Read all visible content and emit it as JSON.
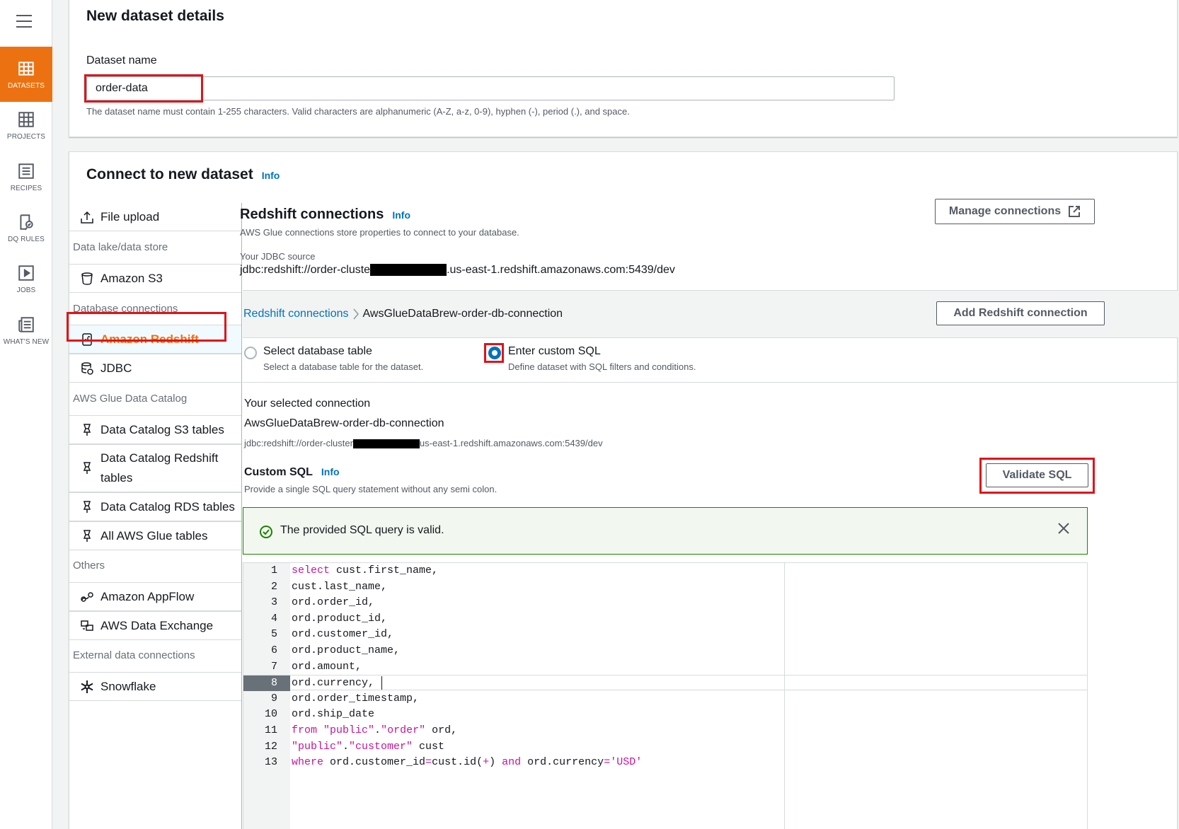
{
  "rail": {
    "items": [
      {
        "label": "DATASETS",
        "icon": "table-icon"
      },
      {
        "label": "PROJECTS",
        "icon": "grid-icon"
      },
      {
        "label": "RECIPES",
        "icon": "list-icon"
      },
      {
        "label": "DQ RULES",
        "icon": "rules-icon"
      },
      {
        "label": "JOBS",
        "icon": "play-icon"
      },
      {
        "label": "WHAT'S NEW",
        "icon": "news-icon"
      }
    ]
  },
  "details": {
    "title": "New dataset details",
    "name_label": "Dataset name",
    "name_value": "order-data",
    "name_hint": "The dataset name must contain 1-255 characters. Valid characters are alphanumeric (A-Z, a-z, 0-9), hyphen (-), period (.), and space."
  },
  "connect": {
    "title": "Connect to new dataset",
    "info": "Info"
  },
  "sources": {
    "file_upload": "File upload",
    "group_lake": "Data lake/data store",
    "s3": "Amazon S3",
    "group_db": "Database connections",
    "redshift": "Amazon Redshift",
    "jdbc": "JDBC",
    "group_catalog": "AWS Glue Data Catalog",
    "catalog_s3": "Data Catalog S3 tables",
    "catalog_redshift_1": "Data Catalog Redshift",
    "catalog_redshift_2": "tables",
    "catalog_rds": "Data Catalog RDS tables",
    "all_glue": "All AWS Glue tables",
    "group_others": "Others",
    "appflow": "Amazon AppFlow",
    "data_exchange": "AWS Data Exchange",
    "group_external": "External data connections",
    "snowflake": "Snowflake"
  },
  "redshift": {
    "title": "Redshift connections",
    "info": "Info",
    "subtitle": "AWS Glue connections store properties to connect to your database.",
    "manage_btn": "Manage connections",
    "jdbc_label": "Your JDBC source",
    "jdbc_prefix": "jdbc:redshift://order-cluste",
    "jdbc_suffix": ".us-east-1.redshift.amazonaws.com:5439/dev",
    "crumb_link": "Redshift connections",
    "crumb_current": "AwsGlueDataBrew-order-db-connection",
    "add_btn": "Add Redshift connection",
    "radio_table": "Select database table",
    "radio_table_hint": "Select a database table for the dataset.",
    "radio_sql": "Enter custom SQL",
    "radio_sql_hint": "Define dataset with SQL filters and conditions.",
    "selected_label": "Your selected connection",
    "selected_name": "AwsGlueDataBrew-order-db-connection",
    "selected_prefix": "jdbc:redshift://order-cluster",
    "selected_suffix": "us-east-1.redshift.amazonaws.com:5439/dev",
    "custom_sql_label": "Custom SQL",
    "custom_sql_info": "Info",
    "custom_sql_hint": "Provide a single SQL query statement without any semi colon.",
    "validate_btn": "Validate SQL",
    "alert_text": "The provided SQL query is valid."
  },
  "editor": {
    "lines": [
      {
        "n": "1",
        "kw": "select",
        "rest": " cust.first_name,"
      },
      {
        "n": "2",
        "kw": "",
        "rest": "cust.last_name,"
      },
      {
        "n": "3",
        "kw": "",
        "rest": "ord.order_id,"
      },
      {
        "n": "4",
        "kw": "",
        "rest": "ord.product_id,"
      },
      {
        "n": "5",
        "kw": "",
        "rest": "ord.customer_id,"
      },
      {
        "n": "6",
        "kw": "",
        "rest": "ord.product_name,"
      },
      {
        "n": "7",
        "kw": "",
        "rest": "ord.amount,"
      },
      {
        "n": "8",
        "kw": "",
        "rest": "ord.currency,"
      },
      {
        "n": "9",
        "kw": "",
        "rest": "ord.order_timestamp,"
      },
      {
        "n": "10",
        "kw": "",
        "rest": "ord.ship_date"
      },
      {
        "n": "11",
        "kw": "from",
        "rest": " \"public\".\"order\" ord,"
      },
      {
        "n": "12",
        "kw": "",
        "rest": "\"public\".\"customer\" cust"
      },
      {
        "n": "13",
        "kw": "where",
        "rest": " ord.customer_id=cust.id(+) and ord.currency='USD'"
      }
    ]
  },
  "colors": {
    "accent": "#ec7211",
    "link": "#0073bb",
    "highlight": "#e0131a",
    "success": "#1d8102"
  }
}
